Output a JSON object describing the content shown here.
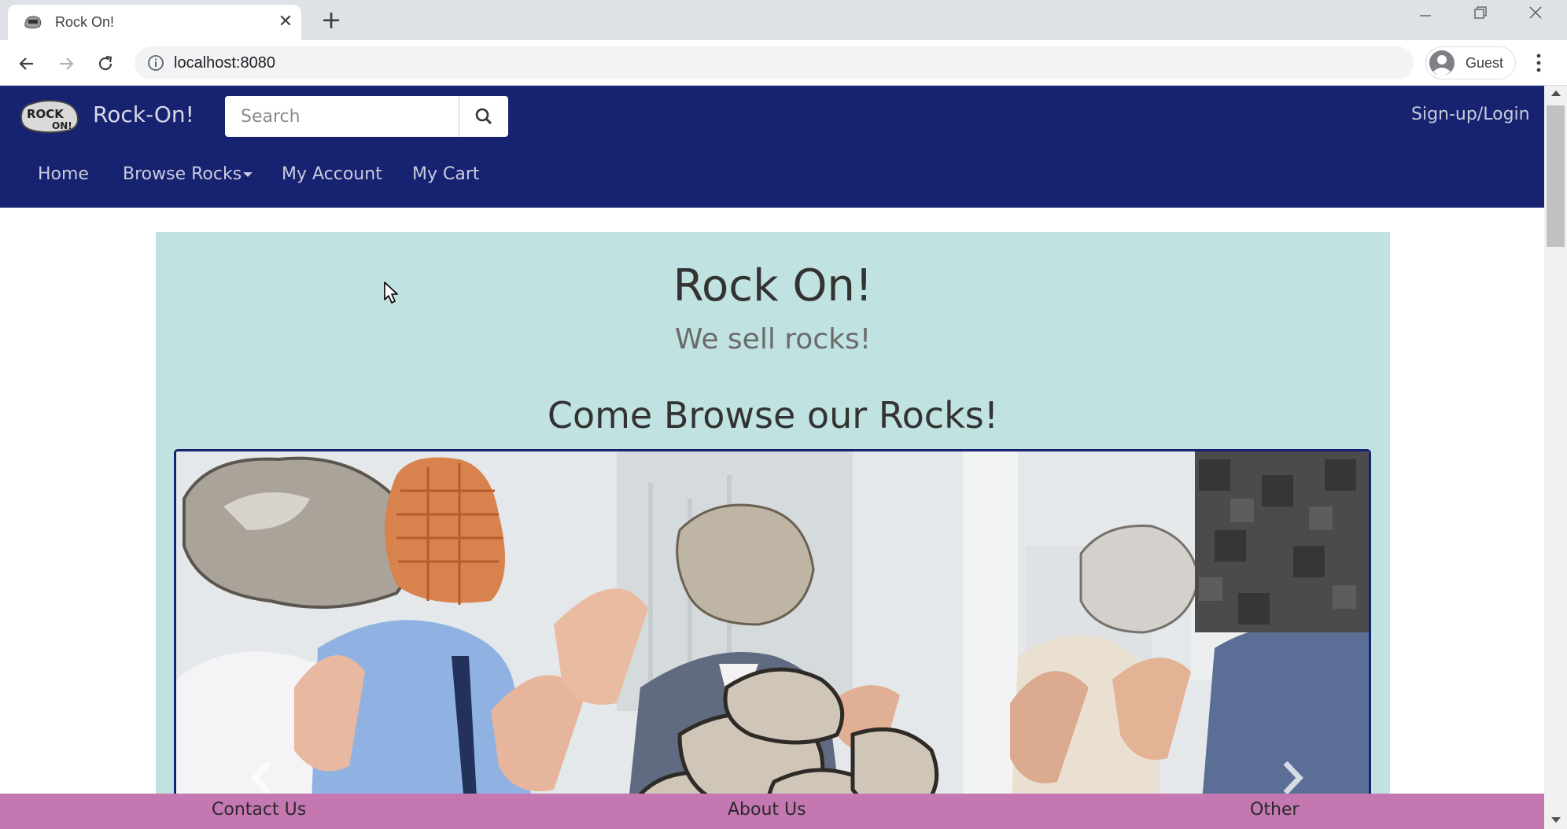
{
  "browser": {
    "tab_title": "Rock On!",
    "tab_close": "✕",
    "new_tab": "+",
    "url": "localhost:8080",
    "profile_name": "Guest"
  },
  "navbar": {
    "brand": "Rock-On!",
    "logo_text_top": "ROCK",
    "logo_text_bottom": "ON!",
    "search_placeholder": "Search",
    "signup": "Sign-up/Login",
    "menu": [
      {
        "label": "Home"
      },
      {
        "label": "Browse Rocks"
      },
      {
        "label": "My Account"
      },
      {
        "label": "My Cart"
      }
    ]
  },
  "hero": {
    "title": "Rock On!",
    "subtitle": "We sell rocks!",
    "browse_heading": "Come Browse our Rocks!"
  },
  "footer": {
    "links": [
      {
        "label": "Contact Us"
      },
      {
        "label": "About Us"
      },
      {
        "label": "Other"
      }
    ]
  },
  "colors": {
    "navbar": "#172370",
    "jumbotron": "#c0e2e0",
    "footer": "#c577b2",
    "carousel_border": "#172370"
  }
}
